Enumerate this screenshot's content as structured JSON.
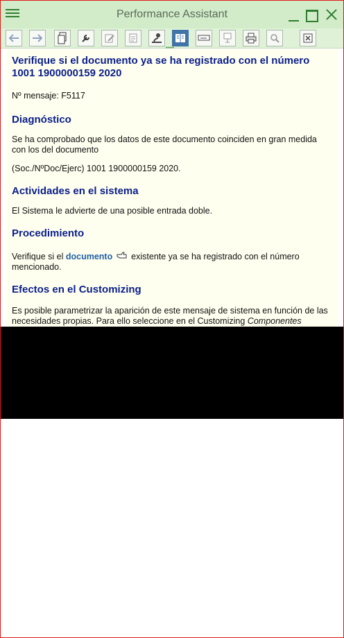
{
  "window": {
    "title": "Performance Assistant"
  },
  "toolbar": {
    "buttons": [
      {
        "name": "back-button",
        "icon": "arrow-left-icon"
      },
      {
        "name": "forward-button",
        "icon": "arrow-right-icon"
      },
      {
        "name": "document-button",
        "icon": "document-icon"
      },
      {
        "name": "technical-info-button",
        "icon": "wrench-icon"
      },
      {
        "name": "edit-button",
        "icon": "pencil-icon"
      },
      {
        "name": "print-preview-button",
        "icon": "page-icon"
      },
      {
        "name": "assistant-button",
        "icon": "person-icon"
      },
      {
        "name": "long-text-button",
        "icon": "book-icon",
        "active": true
      },
      {
        "name": "notes-button",
        "icon": "note-icon"
      },
      {
        "name": "structure-button",
        "icon": "tree-icon"
      },
      {
        "name": "print-button",
        "icon": "printer-icon"
      },
      {
        "name": "find-button",
        "icon": "magnifier-icon"
      },
      {
        "name": "close-button",
        "icon": "close-icon"
      }
    ]
  },
  "colors": {
    "heading": "#0a1e8a",
    "link": "#2060a8",
    "background": "#fffff0",
    "titlebar": "#d2ecc9"
  },
  "doc": {
    "title": "Verifique si el documento ya se ha registrado con el número 1001 1900000159 2020",
    "message_no": "Nº mensaje: F5117",
    "sections": [
      {
        "heading": "Diagnóstico",
        "p1": "Se ha comprobado que los datos de este documento coinciden en gran medida con los del documento",
        "p2": "(Soc./NºDoc/Ejerc) 1001 1900000159 2020."
      },
      {
        "heading": "Actividades en el sistema",
        "p1": "El Sistema le advierte de una posible entrada doble."
      },
      {
        "heading": "Procedimiento",
        "p1_pre": "Verifique si el",
        "p1_link": "documento",
        "p1_post": "existente ya se ha registrado con el número mencionado."
      },
      {
        "heading": "Efectos en el Customizing",
        "p1_pre": "Es posible parametrizar la aparición de este mensaje de sistema en función de las necesidades propias. Para ello seleccione en el Customizing",
        "p1_italic": "Componentes"
      }
    ]
  }
}
